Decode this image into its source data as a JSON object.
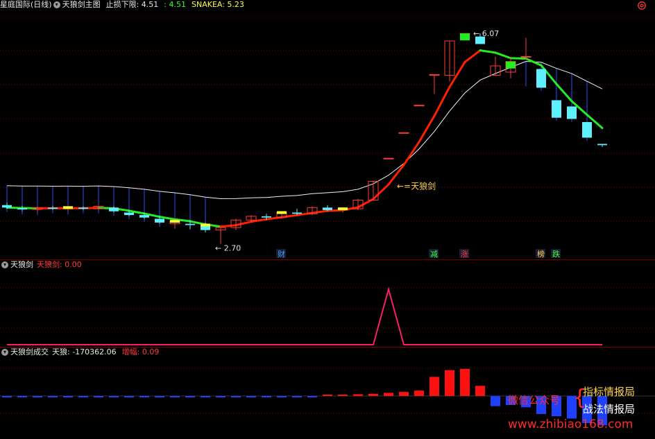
{
  "main_panel": {
    "stock_name": "星庭国际(日线)",
    "indicator_name": "天狼剑主图",
    "stop_loss_label": "止损下限: 4.51",
    "value_green": ": 4.51",
    "snake_label": "SNAKEA: 5.23",
    "high_label": "6.07",
    "low_label": "2.70",
    "sword_label": "←=天狼剑",
    "signals": [
      {
        "text": "财",
        "color": "#3aa0ff"
      },
      {
        "text": "减",
        "color": "#35ff35"
      },
      {
        "text": "涨",
        "color": "#ff3b3b"
      },
      {
        "text": "榜",
        "color": "#ffd34a"
      },
      {
        "text": "跌",
        "color": "#35ff35"
      }
    ]
  },
  "indicator1": {
    "name": "天狼剑",
    "value_label": "天狼剑: 0.00"
  },
  "indicator2": {
    "name": "天狼剑成交",
    "value_label": "天狼: -170362.06",
    "increase_label": "增幅: 0.09"
  },
  "watermark": {
    "wechat": "微信公众号",
    "line1": "指标情报局",
    "line2": "战法情报局",
    "url": "www.zhibiao168.com"
  },
  "colors": {
    "up": "#ff3b3b",
    "down": "#5ff0ff",
    "ma_red": "#ff2000",
    "ma_green": "#22ee22",
    "grid": "#7a0000"
  },
  "chart_data": [
    {
      "type": "candlestick",
      "title": "天狼剑主图",
      "candles": [
        {
          "o": 3.32,
          "h": 3.36,
          "l": 3.26,
          "c": 3.28
        },
        {
          "o": 3.27,
          "h": 3.31,
          "l": 3.22,
          "c": 3.25
        },
        {
          "o": 3.25,
          "h": 3.3,
          "l": 3.21,
          "c": 3.28
        },
        {
          "o": 3.28,
          "h": 3.31,
          "l": 3.24,
          "c": 3.26
        },
        {
          "o": 3.26,
          "h": 3.3,
          "l": 3.22,
          "c": 3.28
        },
        {
          "o": 3.28,
          "h": 3.3,
          "l": 3.24,
          "c": 3.26
        },
        {
          "o": 3.26,
          "h": 3.32,
          "l": 3.24,
          "c": 3.3
        },
        {
          "o": 3.28,
          "h": 3.3,
          "l": 3.2,
          "c": 3.22
        },
        {
          "o": 3.2,
          "h": 3.24,
          "l": 3.14,
          "c": 3.16
        },
        {
          "o": 3.16,
          "h": 3.2,
          "l": 3.1,
          "c": 3.12
        },
        {
          "o": 3.1,
          "h": 3.14,
          "l": 3.02,
          "c": 3.04
        },
        {
          "o": 3.02,
          "h": 3.08,
          "l": 2.95,
          "c": 3.06
        },
        {
          "o": 3.02,
          "h": 3.08,
          "l": 2.93,
          "c": 3.0
        },
        {
          "o": 3.0,
          "h": 3.04,
          "l": 2.88,
          "c": 2.92
        },
        {
          "o": 2.92,
          "h": 2.96,
          "l": 2.7,
          "c": 2.96
        },
        {
          "o": 2.96,
          "h": 3.1,
          "l": 2.92,
          "c": 3.08
        },
        {
          "o": 3.08,
          "h": 3.16,
          "l": 3.04,
          "c": 3.14
        },
        {
          "o": 3.14,
          "h": 3.18,
          "l": 3.08,
          "c": 3.12
        },
        {
          "o": 3.12,
          "h": 3.22,
          "l": 3.1,
          "c": 3.2
        },
        {
          "o": 3.2,
          "h": 3.26,
          "l": 3.16,
          "c": 3.18
        },
        {
          "o": 3.18,
          "h": 3.3,
          "l": 3.16,
          "c": 3.28
        },
        {
          "o": 3.28,
          "h": 3.32,
          "l": 3.22,
          "c": 3.24
        },
        {
          "o": 3.24,
          "h": 3.28,
          "l": 3.2,
          "c": 3.26
        },
        {
          "o": 3.26,
          "h": 3.42,
          "l": 3.24,
          "c": 3.4
        },
        {
          "o": 3.4,
          "h": 3.7,
          "l": 3.4,
          "c": 3.7
        },
        {
          "o": 4.07,
          "h": 4.07,
          "l": 4.07,
          "c": 4.07
        },
        {
          "o": 4.48,
          "h": 4.48,
          "l": 4.48,
          "c": 4.48
        },
        {
          "o": 4.92,
          "h": 4.92,
          "l": 4.92,
          "c": 4.92
        },
        {
          "o": 5.41,
          "h": 5.41,
          "l": 5.1,
          "c": 5.41
        },
        {
          "o": 5.4,
          "h": 5.95,
          "l": 5.3,
          "c": 5.95
        },
        {
          "o": 6.07,
          "h": 6.07,
          "l": 6.07,
          "c": 6.07
        },
        {
          "o": 6.02,
          "h": 6.07,
          "l": 5.9,
          "c": 5.9
        },
        {
          "o": 5.4,
          "h": 5.7,
          "l": 5.4,
          "c": 5.55
        },
        {
          "o": 5.45,
          "h": 5.7,
          "l": 5.35,
          "c": 5.62
        },
        {
          "o": 5.7,
          "h": 6.0,
          "l": 5.65,
          "c": 5.7
        },
        {
          "o": 5.5,
          "h": 5.5,
          "l": 5.2,
          "c": 5.2
        },
        {
          "o": 5.0,
          "h": 5.0,
          "l": 4.72,
          "c": 4.72
        },
        {
          "o": 4.9,
          "h": 4.9,
          "l": 4.7,
          "c": 4.7
        },
        {
          "o": 4.65,
          "h": 4.65,
          "l": 4.4,
          "c": 4.4
        },
        {
          "o": 4.3,
          "h": 4.3,
          "l": 4.25,
          "c": 4.28
        }
      ],
      "ylim": [
        2.45,
        6.45
      ],
      "price_high": 6.07,
      "price_low": 2.7
    },
    {
      "type": "line",
      "title": "天狼剑",
      "values": [
        0,
        0,
        0,
        0,
        0,
        0,
        0,
        0,
        0,
        0,
        0,
        0,
        0,
        0,
        0,
        0,
        0,
        0,
        0,
        0,
        0,
        0,
        0,
        0,
        0,
        1,
        0,
        0,
        0,
        0,
        0,
        0,
        0,
        0,
        0,
        0,
        0,
        0,
        0,
        0
      ],
      "ylim": [
        0,
        1.3
      ]
    },
    {
      "type": "bar",
      "title": "天狼剑成交",
      "values": [
        -0.02,
        -0.02,
        -0.02,
        -0.02,
        -0.02,
        -0.02,
        -0.02,
        -0.02,
        -0.02,
        -0.02,
        -0.02,
        -0.02,
        -0.02,
        -0.02,
        -0.02,
        -0.02,
        -0.02,
        -0.02,
        -0.02,
        -0.02,
        -0.02,
        0.02,
        0.04,
        0.08,
        0.1,
        0.14,
        0.18,
        0.24,
        0.85,
        1.15,
        1.2,
        0.45,
        -0.45,
        -0.4,
        -0.5,
        -0.8,
        -0.9,
        -1.0,
        -1.2,
        -1.3
      ],
      "ylim": [
        -1.6,
        1.6
      ]
    }
  ]
}
